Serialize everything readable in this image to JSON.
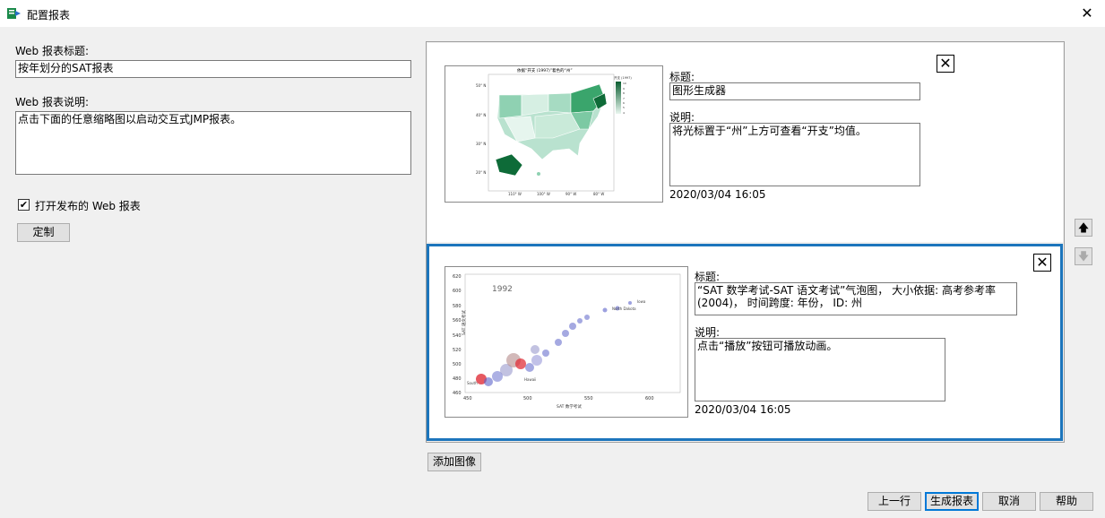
{
  "window": {
    "title": "配置报表",
    "close": "✕"
  },
  "left": {
    "title_label": "Web 报表标题:",
    "title_value": "按年划分的SAT报表",
    "desc_label": "Web 报表说明:",
    "desc_value": "点击下面的任意缩略图以启动交互式JMP报表。",
    "open_checkbox_label": "打开发布的 Web 报表",
    "open_checkbox_checked": true,
    "customize_button": "定制"
  },
  "reports": [
    {
      "title_label": "标题:",
      "title_value": "图形生成器",
      "desc_label": "说明:",
      "desc_value": "将光标置于“州”上方可查看“开支”均值。",
      "timestamp": "2020/03/04 16:05",
      "thumb": {
        "heading": "依据“开支 (1997)”着色的“州”",
        "legend_title": "开支 (1997)",
        "legend_ticks": [
          "10",
          "9",
          "8",
          "7",
          "6",
          "5",
          "4"
        ],
        "y_ticks": [
          "50° N",
          "40° N",
          "30° N",
          "20° N"
        ],
        "x_ticks": [
          "110° W",
          "100° W",
          "90° W",
          "80° W"
        ]
      }
    },
    {
      "title_label": "标题:",
      "title_value": "“SAT 数学考试-SAT 语文考试”气泡图， 大小依据: 高考参考率 (2004)， 时间跨度: 年份， ID: 州",
      "desc_label": "说明:",
      "desc_value": "点击“播放”按钮可播放动画。",
      "timestamp": "2020/03/04 16:05",
      "thumb": {
        "year_label": "1992",
        "y_ticks": [
          "620",
          "600",
          "580",
          "560",
          "540",
          "520",
          "500",
          "480",
          "460"
        ],
        "x_ticks": [
          "450",
          "500",
          "550",
          "600"
        ],
        "xlabel": "SAT 数学考试",
        "ylabel": "SAT 语文考试",
        "point_labels": [
          "Iowa",
          "North Dakota",
          "South",
          "Hawaii"
        ]
      }
    }
  ],
  "side_buttons": {
    "up": "🡅",
    "down": "🡇"
  },
  "add_image_button": "添加图像",
  "footer": {
    "prev": "上一行",
    "generate": "生成报表",
    "cancel": "取消",
    "help": "帮助"
  },
  "colors": {
    "accent": "#1c75bc",
    "map_green": "#1a8a4a",
    "bubble_blue": "#5b63c9",
    "bubble_red": "#e0303a"
  }
}
